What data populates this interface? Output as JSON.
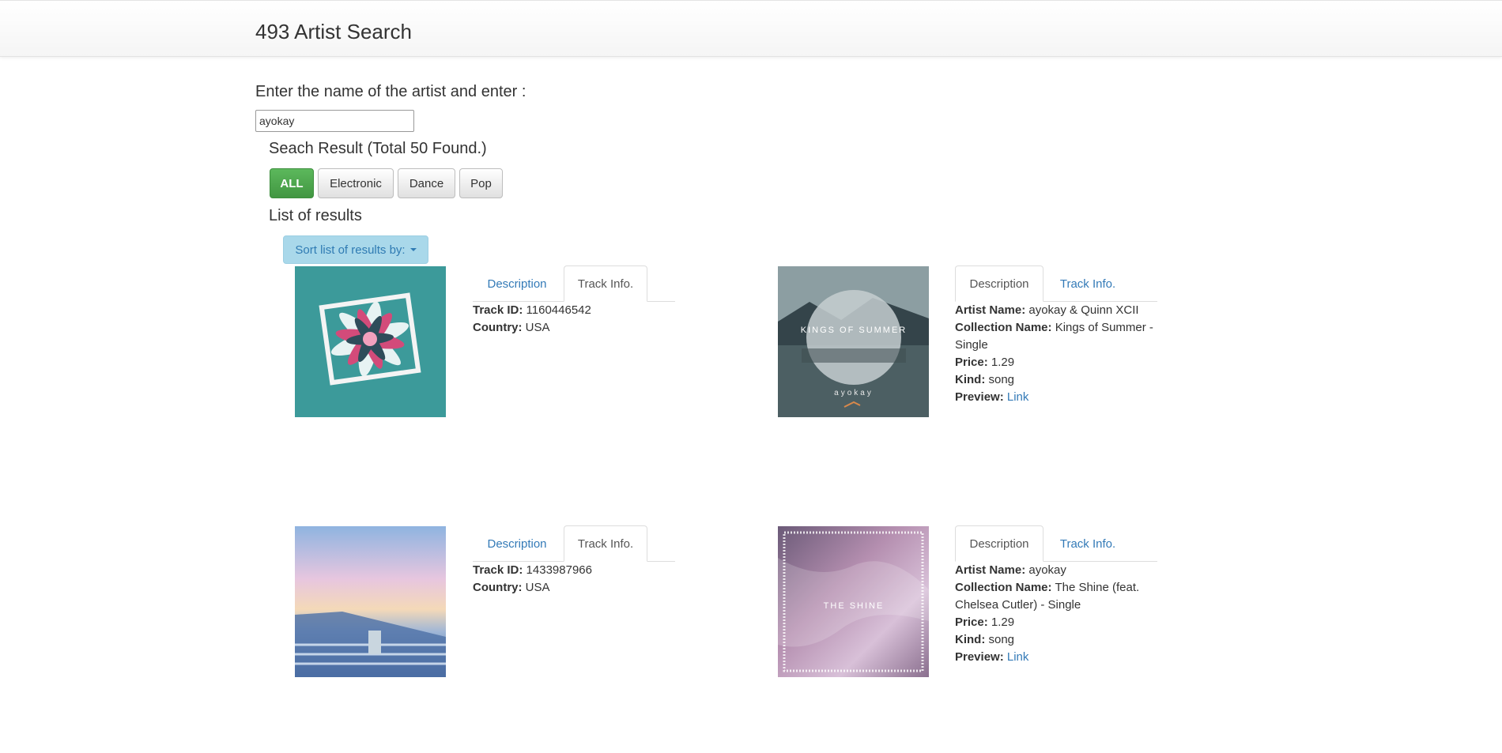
{
  "header": {
    "brand": "493 Artist Search"
  },
  "search": {
    "prompt": "Enter the name of the artist and enter :",
    "value": "ayokay"
  },
  "results": {
    "title": "Seach Result (Total 50 Found.)",
    "filters": [
      "ALL",
      "Electronic",
      "Dance",
      "Pop"
    ],
    "list_title": "List of results",
    "sort_label": "Sort list of results by:"
  },
  "tabs": {
    "description": "Description",
    "track_info": "Track Info."
  },
  "labels": {
    "track_id": "Track ID:",
    "country": "Country:",
    "artist_name": "Artist Name:",
    "collection_name": "Collection Name:",
    "price": "Price:",
    "kind": "Kind:",
    "preview": "Preview:",
    "link": "Link"
  },
  "cards": [
    {
      "artwork_icon": "papercut-flower-artwork",
      "active_tab": "Track Info.",
      "track_id": "1160446542",
      "country": "USA"
    },
    {
      "artwork_icon": "kings-of-summer-artwork",
      "artwork_text": "KINGS OF SUMMER",
      "artwork_sub": "ayokay",
      "active_tab": "Description",
      "artist_name": "ayokay & Quinn XCII",
      "collection_name": "Kings of Summer - Single",
      "price": "1.29",
      "kind": "song"
    },
    {
      "artwork_icon": "sunset-pier-artwork",
      "active_tab": "Track Info.",
      "track_id": "1433987966",
      "country": "USA"
    },
    {
      "artwork_icon": "the-shine-artwork",
      "artwork_text": "THE SHINE",
      "active_tab": "Description",
      "artist_name": "ayokay",
      "collection_name": "The Shine (feat. Chelsea Cutler) - Single",
      "price": "1.29",
      "kind": "song"
    }
  ]
}
